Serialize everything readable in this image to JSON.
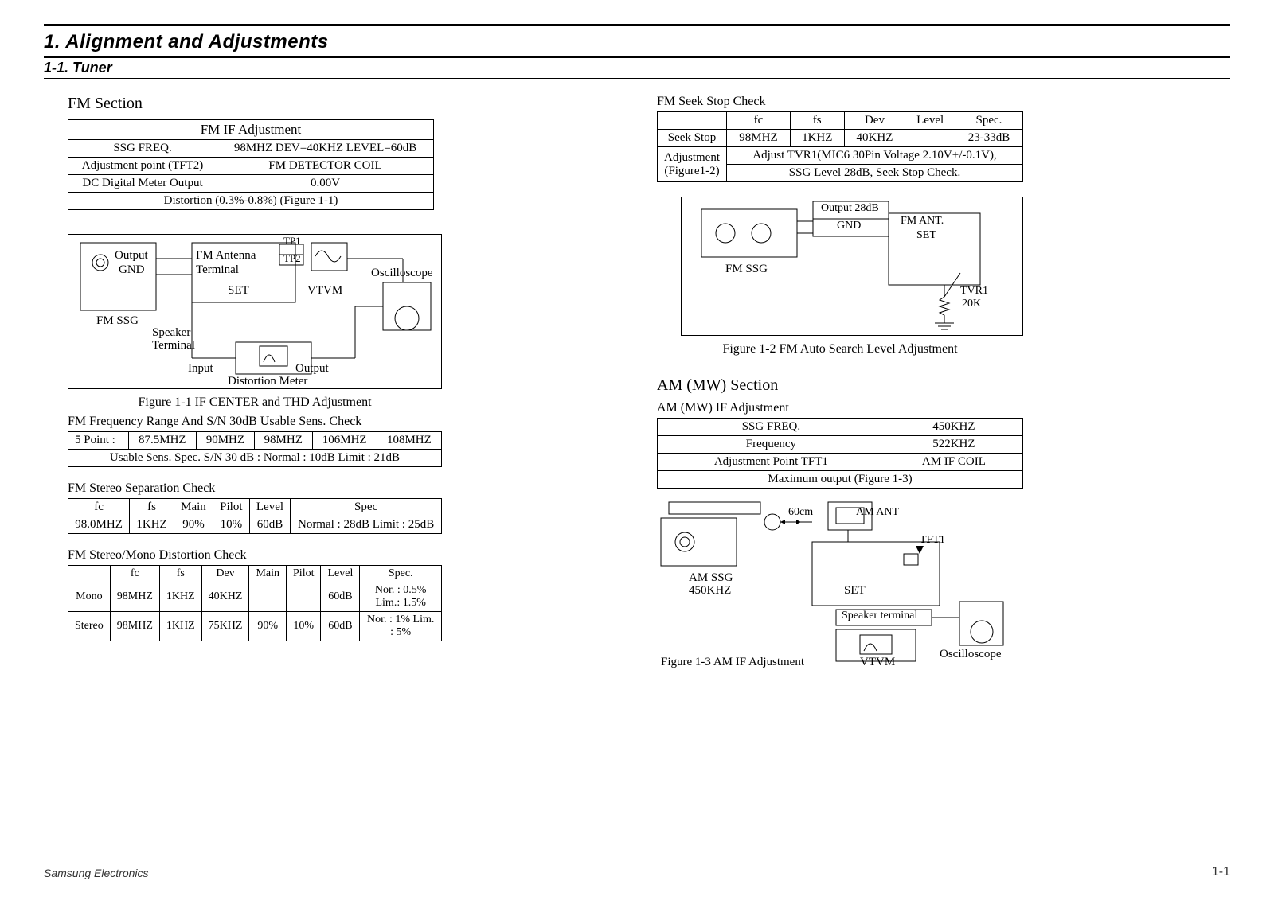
{
  "page": {
    "title": "1. Alignment and Adjustments",
    "subtitle": "1-1. Tuner",
    "footer_left": "Samsung Electronics",
    "footer_right": "1-1"
  },
  "fm_section": {
    "heading": "FM Section",
    "if_adj": {
      "caption": "FM IF Adjustment",
      "rows": [
        [
          "SSG FREQ.",
          "98MHZ DEV=40KHZ LEVEL=60dB"
        ],
        [
          "Adjustment point (TFT2)",
          "FM DETECTOR COIL"
        ],
        [
          "DC Digital Meter Output",
          "0.00V"
        ]
      ],
      "footer": "Distortion (0.3%-0.8%) (Figure 1-1)"
    },
    "fig1_1": {
      "labels": {
        "output": "Output",
        "gnd": "GND",
        "fm_ant": "FM Antenna",
        "terminal": "Terminal",
        "set": "SET",
        "tp1": "TP1",
        "tp2": "TP2",
        "vtvm": "VTVM",
        "oscilloscope": "Oscilloscope",
        "fm_ssg": "FM SSG",
        "speaker": "Speaker",
        "terminal2": "Terminal",
        "input": "Input",
        "output2": "Output",
        "dist_meter": "Distortion Meter"
      },
      "caption": "Figure 1-1 IF CENTER and THD Adjustment"
    },
    "freq_range": {
      "title": "FM Frequency Range And S/N 30dB Usable Sens. Check",
      "row1_label": "5  Point :",
      "points": [
        "87.5MHZ",
        "90MHZ",
        "98MHZ",
        "106MHZ",
        "108MHZ"
      ],
      "row2": "Usable Sens. Spec. S/N 30 dB : Normal : 10dB   Limit : 21dB"
    },
    "stereo_sep": {
      "title": "FM Stereo Separation Check",
      "headers": [
        "fc",
        "fs",
        "Main",
        "Pilot",
        "Level",
        "Spec"
      ],
      "row": [
        "98.0MHZ",
        "1KHZ",
        "90%",
        "10%",
        "60dB",
        "Normal : 28dB Limit : 25dB"
      ]
    },
    "dist_check": {
      "title": "FM Stereo/Mono Distortion Check",
      "headers": [
        "",
        "fc",
        "fs",
        "Dev",
        "Main",
        "Pilot",
        "Level",
        "Spec."
      ],
      "rows": [
        [
          "Mono",
          "98MHZ",
          "1KHZ",
          "40KHZ",
          "",
          "",
          "60dB",
          "Nor. : 0.5%   Lim.: 1.5%"
        ],
        [
          "Stereo",
          "98MHZ",
          "1KHZ",
          "75KHZ",
          "90%",
          "10%",
          "60dB",
          "Nor. : 1%   Lim. : 5%"
        ]
      ]
    }
  },
  "seek_stop": {
    "title": "FM Seek Stop Check",
    "headers": [
      "",
      "fc",
      "fs",
      "Dev",
      "Level",
      "Spec."
    ],
    "row1": [
      "Seek Stop",
      "98MHZ",
      "1KHZ",
      "40KHZ",
      "",
      "23-33dB"
    ],
    "row2_label": "Adjustment\n(Figure1-2)",
    "row2_text1": "Adjust TVR1(MIC6 30Pin Voltage 2.10V+/-0.1V),",
    "row2_text2": "SSG Level 28dB, Seek Stop Check."
  },
  "fig1_2": {
    "labels": {
      "output28": "Output 28dB",
      "gnd": "GND",
      "fm_ant": "FM ANT.",
      "set": "SET",
      "fm_ssg": "FM SSG",
      "tvr1": "TVR1",
      "tvr1_val": "20K"
    },
    "caption": "Figure 1-2 FM Auto Search Level Adjustment"
  },
  "am_section": {
    "heading": "AM (MW) Section",
    "if_adj": {
      "title": "AM (MW) IF Adjustment",
      "rows": [
        [
          "SSG FREQ.",
          "450KHZ"
        ],
        [
          "Frequency",
          "522KHZ"
        ],
        [
          "Adjustment Point TFT1",
          "AM IF COIL"
        ]
      ],
      "footer": "Maximum output (Figure 1-3)"
    },
    "fig1_3": {
      "labels": {
        "len": "60cm",
        "am_ant": "AM ANT",
        "tft1": "TFT1",
        "am_ssg": "AM SSG",
        "freq": "450KHZ",
        "set": "SET",
        "speaker_term": "Speaker terminal",
        "oscilloscope": "Oscilloscope",
        "vtvm": "VTVM"
      },
      "caption": "Figure 1-3 AM IF Adjustment"
    }
  }
}
